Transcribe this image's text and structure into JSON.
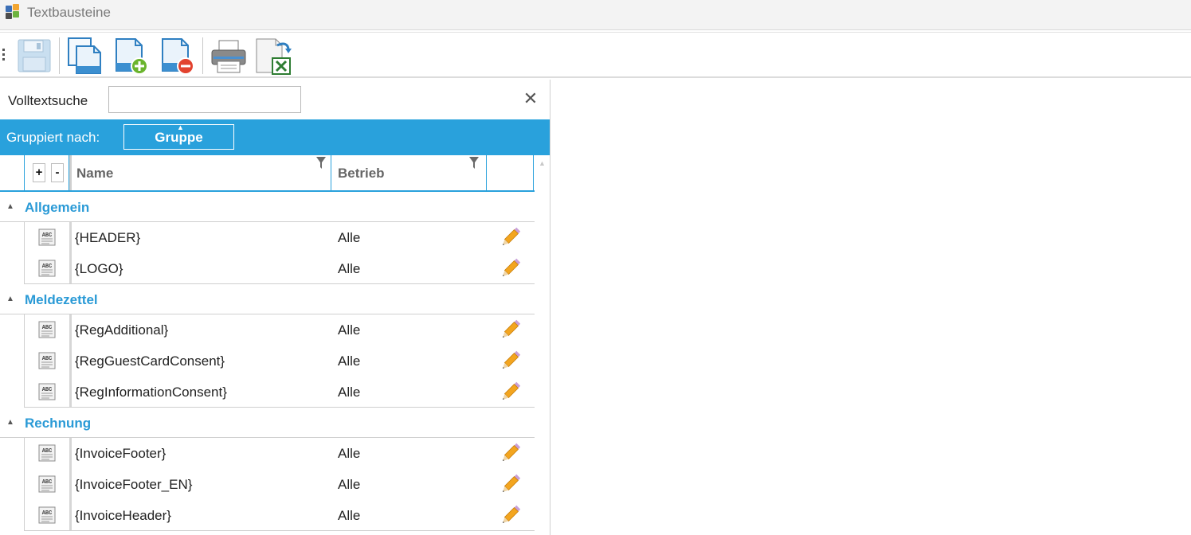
{
  "window": {
    "title": "Textbausteine"
  },
  "toolbar": {
    "buttons": [
      {
        "name": "save",
        "icon": "floppy-disk-icon"
      },
      {
        "name": "copy",
        "icon": "copy-document-icon"
      },
      {
        "name": "new",
        "icon": "add-document-icon"
      },
      {
        "name": "delete",
        "icon": "remove-document-icon"
      },
      {
        "name": "print",
        "icon": "printer-icon"
      },
      {
        "name": "export-excel",
        "icon": "excel-export-icon"
      }
    ]
  },
  "search": {
    "label": "Volltextsuche",
    "value": "",
    "clear_icon": "✕"
  },
  "grouping": {
    "label": "Gruppiert nach:",
    "chip": "Gruppe"
  },
  "grid": {
    "columns": {
      "expand_plus": "+",
      "expand_minus": "-",
      "name": "Name",
      "betrieb": "Betrieb"
    },
    "groups": [
      {
        "name": "Allgemein",
        "rows": [
          {
            "name": "{HEADER}",
            "betrieb": "Alle"
          },
          {
            "name": "{LOGO}",
            "betrieb": "Alle"
          }
        ]
      },
      {
        "name": "Meldezettel",
        "rows": [
          {
            "name": "{RegAdditional}",
            "betrieb": "Alle"
          },
          {
            "name": "{RegGuestCardConsent}",
            "betrieb": "Alle"
          },
          {
            "name": "{RegInformationConsent}",
            "betrieb": "Alle"
          }
        ]
      },
      {
        "name": "Rechnung",
        "rows": [
          {
            "name": "{InvoiceFooter}",
            "betrieb": "Alle"
          },
          {
            "name": "{InvoiceFooter_EN}",
            "betrieb": "Alle"
          },
          {
            "name": "{InvoiceHeader}",
            "betrieb": "Alle"
          }
        ]
      }
    ]
  },
  "colors": {
    "accent": "#29a1dc",
    "group_text": "#2a9ad6"
  }
}
